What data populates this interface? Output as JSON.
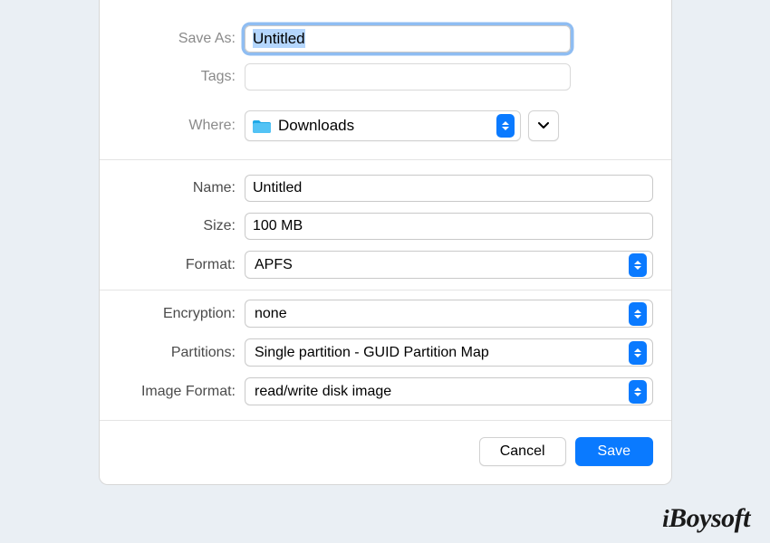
{
  "top": {
    "save_as_label": "Save As:",
    "save_as_value": "Untitled",
    "tags_label": "Tags:",
    "where_label": "Where:",
    "where_value": "Downloads"
  },
  "mid": {
    "name_label": "Name:",
    "name_value": "Untitled",
    "size_label": "Size:",
    "size_value": "100 MB",
    "format_label": "Format:",
    "format_value": "APFS",
    "encryption_label": "Encryption:",
    "encryption_value": "none",
    "partitions_label": "Partitions:",
    "partitions_value": "Single partition - GUID Partition Map",
    "image_format_label": "Image Format:",
    "image_format_value": "read/write disk image"
  },
  "buttons": {
    "cancel": "Cancel",
    "save": "Save"
  },
  "watermark": "iBoysoft"
}
